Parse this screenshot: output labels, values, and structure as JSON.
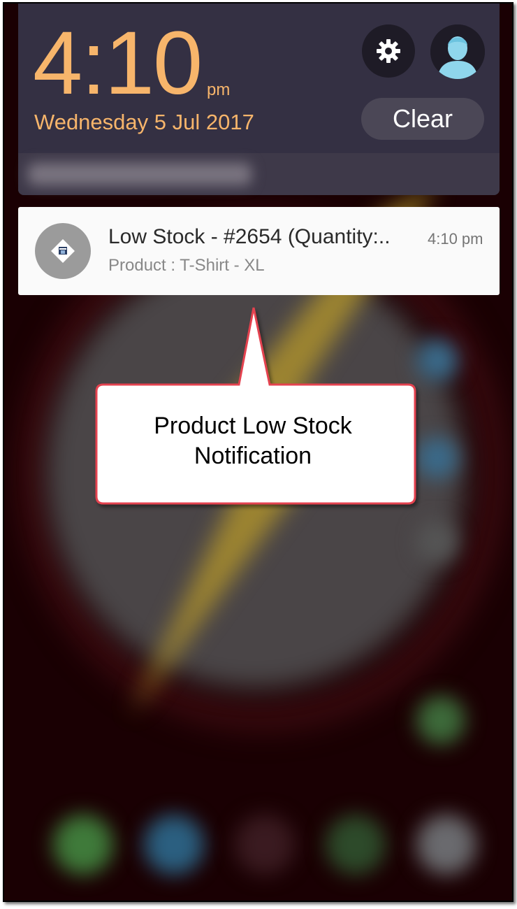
{
  "header": {
    "time": "4:10",
    "ampm": "pm",
    "date": "Wednesday 5 Jul 2017",
    "clear_label": "Clear",
    "settings_icon": "gear-icon",
    "avatar_icon": "user-avatar-icon"
  },
  "notification": {
    "app_icon": "store-icon",
    "title": "Low Stock - #2654 (Quantity:..",
    "time": "4:10 pm",
    "body": "Product : T-Shirt - XL"
  },
  "callout": {
    "text": "Product Low Stock Notification"
  },
  "colors": {
    "accent": "#f7b56b",
    "shade_bg": "#343043",
    "callout_border": "#e4434f",
    "wallpaper": "#1a0003"
  }
}
